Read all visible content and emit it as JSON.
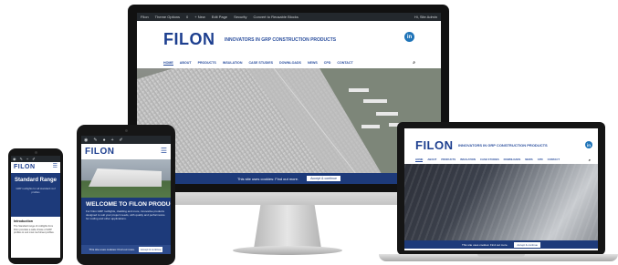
{
  "desktop": {
    "admin_bar": {
      "items": [
        "Filon",
        "Theme Options",
        "0",
        "+ New",
        "Edit Page",
        "Security",
        "Convert to Reusable Blocks"
      ],
      "right": "Hi, Site Admin"
    },
    "logo": "FILON",
    "tagline": "INNOVATORS IN GRP CONSTRUCTION PRODUCTS",
    "linkedin": "in",
    "nav": [
      "HOME",
      "ABOUT",
      "PRODUCTS",
      "INSULATION",
      "CASE STUDIES",
      "DOWNLOADS",
      "NEWS",
      "CPD",
      "CONTACT"
    ],
    "search_icon": "search-icon",
    "cookie_text": "This site uses cookies: Find out more.",
    "cookie_button": "Accept & continue"
  },
  "laptop": {
    "logo": "FILON",
    "tagline": "INNOVATORS IN GRP CONSTRUCTION PRODUCTS",
    "linkedin": "in",
    "nav": [
      "HOME",
      "ABOUT",
      "PRODUCTS",
      "INSULATION",
      "CASE STUDIES",
      "DOWNLOADS",
      "NEWS",
      "CPD",
      "CONTACT"
    ],
    "cookie_text": "This site uses cookies: Find out more.",
    "cookie_button": "Accept & continue"
  },
  "tablet": {
    "logo": "FILON",
    "welcome_title": "WELCOME TO FILON PRODUCTS",
    "welcome_text": "For Filon GRP rooflights, cladding and more, innovative products designed to suit your project needs, with quality and performance for roofing and other applications.",
    "cookie_text": "This site uses cookies: Find out more.",
    "cookie_button": "Accept & continue"
  },
  "phone": {
    "logo": "FILON",
    "banner_title": "Standard Range",
    "banner_subtitle": "GRP rooflights for all standard roof profiles",
    "intro_title": "Introduction",
    "intro_text": "The Standard range of rooflights from Filon provides a wide choice of GRP profiles to suit most roof sheet profiles."
  },
  "colors": {
    "brand_blue": "#1d3f8f",
    "cookie_bar": "#1d3a7a",
    "linkedin": "#1f74b8"
  }
}
